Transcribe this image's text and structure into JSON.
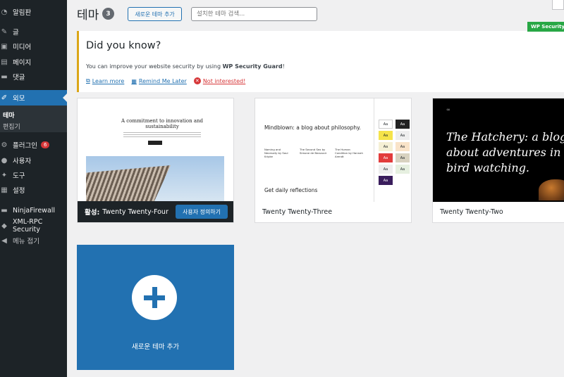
{
  "sidebar": {
    "items": [
      {
        "label": "알림판",
        "icon": "dashboard-icon",
        "glyph": "◔"
      },
      {
        "label": "글",
        "icon": "pin-icon",
        "glyph": "✎"
      },
      {
        "label": "미디어",
        "icon": "media-icon",
        "glyph": "▣"
      },
      {
        "label": "페이지",
        "icon": "page-icon",
        "glyph": "▤"
      },
      {
        "label": "댓글",
        "icon": "comments-icon",
        "glyph": "▬"
      },
      {
        "label": "외모",
        "icon": "appearance-icon",
        "glyph": "✐"
      },
      {
        "label": "플러그인",
        "icon": "plugins-icon",
        "glyph": "⚙",
        "badge": "6"
      },
      {
        "label": "사용자",
        "icon": "users-icon",
        "glyph": "●"
      },
      {
        "label": "도구",
        "icon": "tools-icon",
        "glyph": "✦"
      },
      {
        "label": "설정",
        "icon": "settings-icon",
        "glyph": "▦"
      },
      {
        "label": "NinjaFirewall",
        "icon": "ninja-icon",
        "glyph": "▬"
      },
      {
        "label": "XML-RPC Security",
        "icon": "shield-icon",
        "glyph": "◆"
      },
      {
        "label": "메뉴 접기",
        "icon": "collapse-icon",
        "glyph": "◀"
      }
    ],
    "submenu": [
      {
        "label": "테마"
      },
      {
        "label": "편집기"
      }
    ]
  },
  "header": {
    "title": "테마",
    "count": "3",
    "add_button": "새로운 테마 추가",
    "search_placeholder": "설치한 테마 검색..."
  },
  "security_tag": "WP Security",
  "notice": {
    "title": "Did you know?",
    "text_before": "You can improve your website security by using ",
    "text_bold": "WP Security Guard",
    "text_after": "!",
    "learn_more": "Learn more",
    "remind": "Remind Me Later",
    "not_interested": "Not interested!"
  },
  "themes": [
    {
      "prefix": "활성:",
      "name": "Twenty Twenty-Four",
      "customize": "사용자 정의하기"
    },
    {
      "name": "Twenty Twenty-Three"
    },
    {
      "name": "Twenty Twenty-Two"
    }
  ],
  "previews": {
    "tt4_headline": "A commitment to innovation and sustainability",
    "tt3_title": "Mindblown: a blog about philosophy.",
    "tt3_daily": "Get daily reflections",
    "tt3_cols": [
      "Naming and Necessity by Saul Kripke",
      "The Second Sex by Simone de Beauvoir",
      "The Human Condition by Hannah Arendt"
    ],
    "tt2_text": "The Hatchery: a blog about adventures in bird watching.",
    "swatch_label": "Aa"
  },
  "add_new": {
    "label": "새로운 테마 추가"
  },
  "colors": {
    "sidebar": "#1d2327",
    "accent": "#2271b1",
    "notice_border": "#dba617",
    "danger": "#d63638",
    "security_green": "#28a745"
  }
}
